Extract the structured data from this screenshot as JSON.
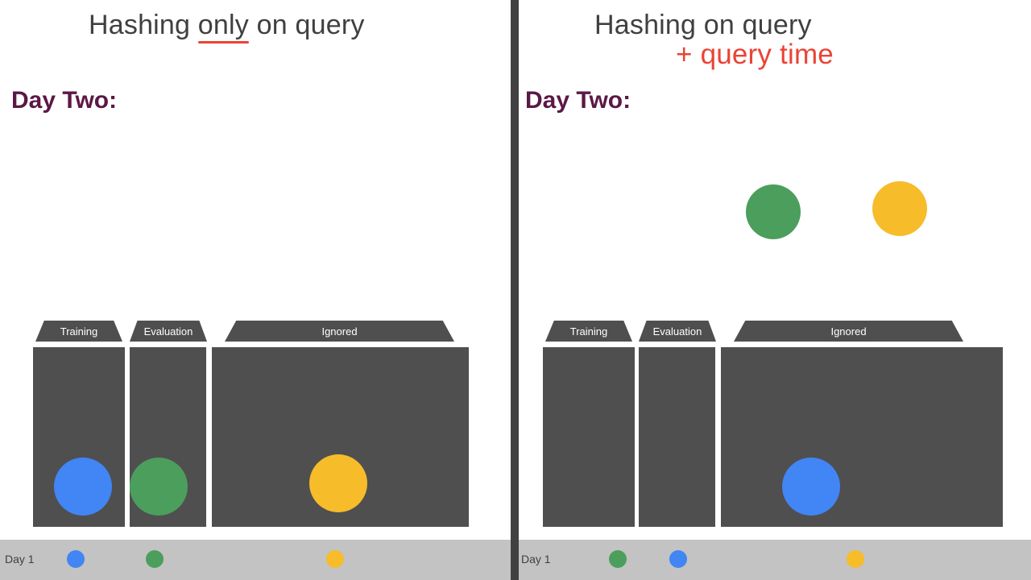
{
  "left": {
    "title_pre": "Hashing ",
    "title_underline": "only",
    "title_post": " on query",
    "day": "Day Two:",
    "buckets": {
      "training": "Training",
      "evaluation": "Evaluation",
      "ignored": "Ignored"
    }
  },
  "right": {
    "title": "Hashing on query",
    "subtitle": "+ query time",
    "day": "Day Two:",
    "buckets": {
      "training": "Training",
      "evaluation": "Evaluation",
      "ignored": "Ignored"
    }
  },
  "footer": {
    "day1": "Day 1"
  },
  "colors": {
    "blue": "#4285f4",
    "green": "#4c9e5c",
    "yellow": "#f7bc2a",
    "accent": "#ea4335",
    "bucket": "#4f4f4f"
  }
}
